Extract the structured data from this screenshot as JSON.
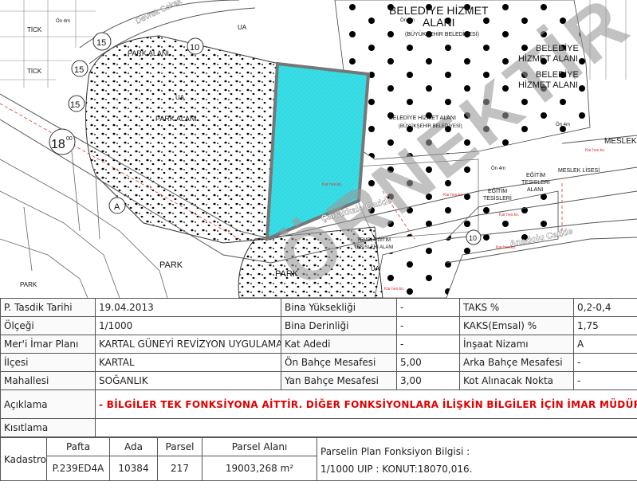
{
  "map": {
    "watermark": "ÖRNEKTİR",
    "labels": {
      "belediye_hizmet_top": "BELEDİYE HİZMET",
      "alani": "ALANI",
      "buyuksehir": "(BÜYÜKŞEHİR BELEDİYESİ)",
      "belediye": "BELEDİYE",
      "hizmet_alani": "HİZMET ALANI",
      "belediye_hizmet_alani_small": "BELEDİYE HİZMET ALANI",
      "buyuksehir_small": "(BÜYÜKŞEHİR BELEDİYESİ)",
      "meslek": "MESLEK",
      "meslek_lisesi": "MESLEK LİSESİ",
      "egitim": "EĞİTİM",
      "tesisleri": "TESİSLERİ",
      "temel_egitim": "TEMEL EĞİTİM",
      "temel_tesisleri": "TESİSLERİ ALANI",
      "park_alani": "PARK ALANI",
      "park": "PARK",
      "cadde": "Çanakkale Cadde",
      "anadolu": "Anadolu Cadde",
      "devrek": "Devrek Sokak",
      "tick": "TİCK",
      "ua": "UA",
      "a": "A",
      "n15": "15",
      "n10": "10",
      "n18": "18",
      "oo": "00",
      "ykd": "Ön 4m",
      "red_small": "Kar hes.ko."
    }
  },
  "info": {
    "tasdik_label": "P. Tasdik Tarihi",
    "tasdik_value": "19.04.2013",
    "bina_yuksekligi_label": "Bina Yüksekliği",
    "bina_yuksekligi_value": "-",
    "taks_label": "TAKS %",
    "taks_value": "0,2-0,4",
    "olcek_label": "Ölçeği",
    "olcek_value": "1/1000",
    "bina_derinligi_label": "Bina Derinliği",
    "bina_derinligi_value": "-",
    "kaks_label": "KAKS(Emsal) %",
    "kaks_value": "1,75",
    "imar_plani_label": "Mer'i İmar Planı",
    "imar_plani_value": "KARTAL GÜNEYİ REVİZYON UYGULAMA İMAR PLANI",
    "kat_adedi_label": "Kat Adedi",
    "kat_adedi_value": "-",
    "insaat_nizami_label": "İnşaat Nizamı",
    "insaat_nizami_value": "A",
    "ilce_label": "İlçesi",
    "ilce_value": "KARTAL",
    "on_bahce_label": "Ön Bahçe Mesafesi",
    "on_bahce_value": "5,00",
    "arka_bahce_label": "Arka Bahçe Mesafesi",
    "arka_bahce_value": "-",
    "mahalle_label": "Mahallesi",
    "mahalle_value": "SOĞANLIK",
    "yan_bahce_label": "Yan Bahçe Mesafesi",
    "yan_bahce_value": "3,00",
    "kot_label": "Kot Alınacak Nokta",
    "kot_value": "-",
    "aciklama_label": "Açıklama",
    "aciklama_value": "- BİLGİLER TEK FONKSİYONA AİTTİR. DİĞER FONKSİYONLARA İLİŞKİN BİLGİLER İÇİN İMAR MÜDÜRLÜĞÜ' NE BAŞVURUNUZ.",
    "kisitlama_label": "Kısıtlama",
    "kisitlama_value": ""
  },
  "kadastro": {
    "label": "Kadastro",
    "headers": [
      "Pafta",
      "Ada",
      "Parsel",
      "Parsel Alanı"
    ],
    "values": [
      "P.239ED4A",
      "10384",
      "217",
      "19003,268 m²"
    ],
    "fonksiyon_title": "Parselin Plan Fonksiyon Bilgisi :",
    "fonksiyon_value": "1/1000 UIP : KONUT:18070,016."
  },
  "colors": {
    "parcel_fill": "#38dde6",
    "parcel_border": "#777777",
    "warning_red": "#e00000",
    "road_red": "#e03030"
  }
}
